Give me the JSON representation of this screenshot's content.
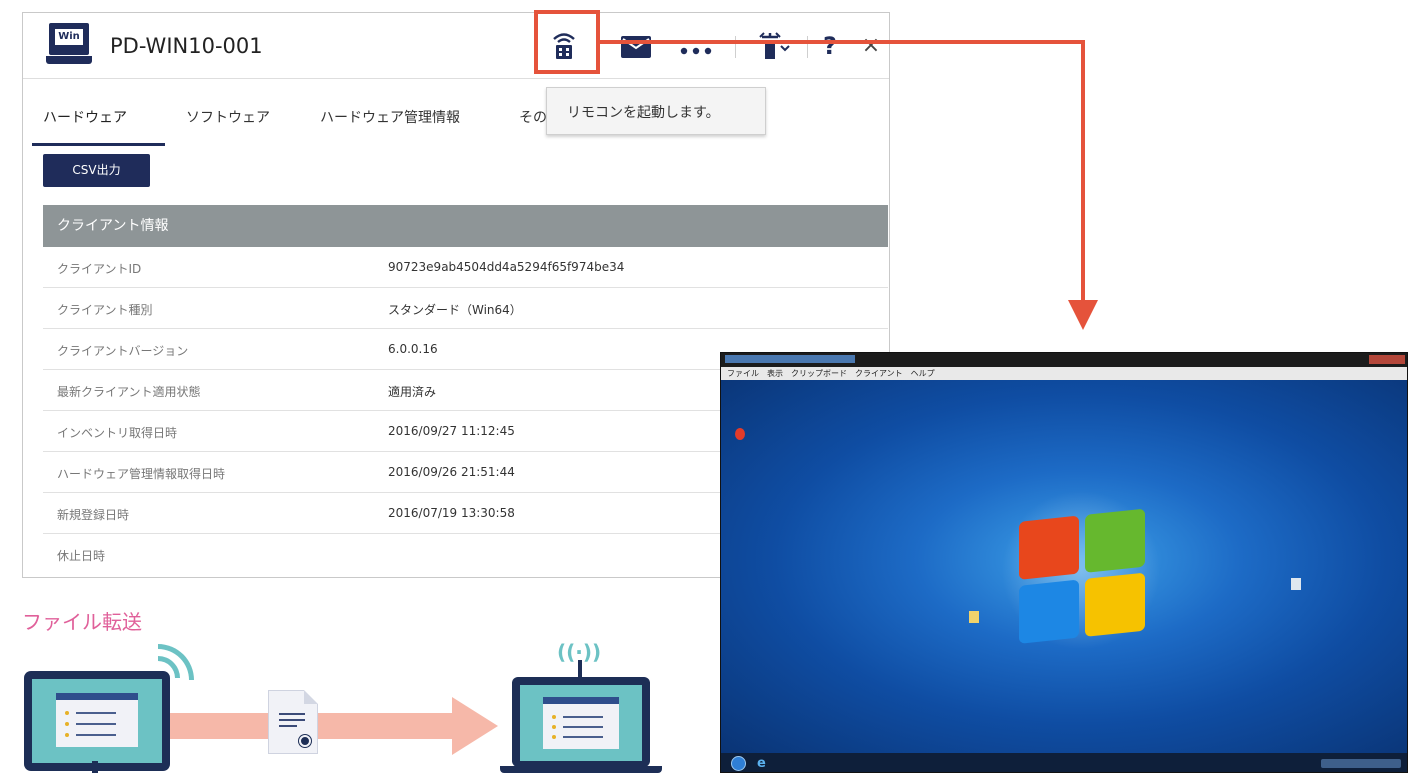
{
  "device": {
    "os_badge": "Win",
    "name": "PD-WIN10-001"
  },
  "toolbar": {
    "remote_icon": "remote-control-icon",
    "mail_icon": "mail-icon",
    "more_icon": "more-icon",
    "power_icon": "power-icon",
    "help_label": "?",
    "close_label": "×"
  },
  "tabs": [
    {
      "label": "ハードウェア",
      "active": true
    },
    {
      "label": "ソフトウェア"
    },
    {
      "label": "ハードウェア管理情報"
    },
    {
      "label": "その"
    }
  ],
  "tooltip": {
    "text": "リモコンを起動します。"
  },
  "csv_button": {
    "label": "CSV出力"
  },
  "client_info": {
    "title": "クライアント情報",
    "rows": [
      {
        "key": "クライアントID",
        "value": "90723e9ab4504dd4a5294f65f974be34"
      },
      {
        "key": "クライアント種別",
        "value": "スタンダード（Win64）"
      },
      {
        "key": "クライアントバージョン",
        "value": "6.0.0.16"
      },
      {
        "key": "最新クライアント適用状態",
        "value": "適用済み"
      },
      {
        "key": "インベントリ取得日時",
        "value": "2016/09/27 11:12:45"
      },
      {
        "key": "ハードウェア管理情報取得日時",
        "value": "2016/09/26 21:51:44"
      },
      {
        "key": "新規登録日時",
        "value": "2016/07/19 13:30:58"
      },
      {
        "key": "休止日時",
        "value": ""
      }
    ]
  },
  "remote_window": {
    "menu": "ファイル　表示　クリップボード　クライアント　ヘルプ"
  },
  "file_transfer": {
    "label": "ファイル転送"
  },
  "colors": {
    "accent": "#1f2c5a",
    "arrow": "#e5533b",
    "label_pink": "#e0609a",
    "teal": "#6cc2c4"
  }
}
